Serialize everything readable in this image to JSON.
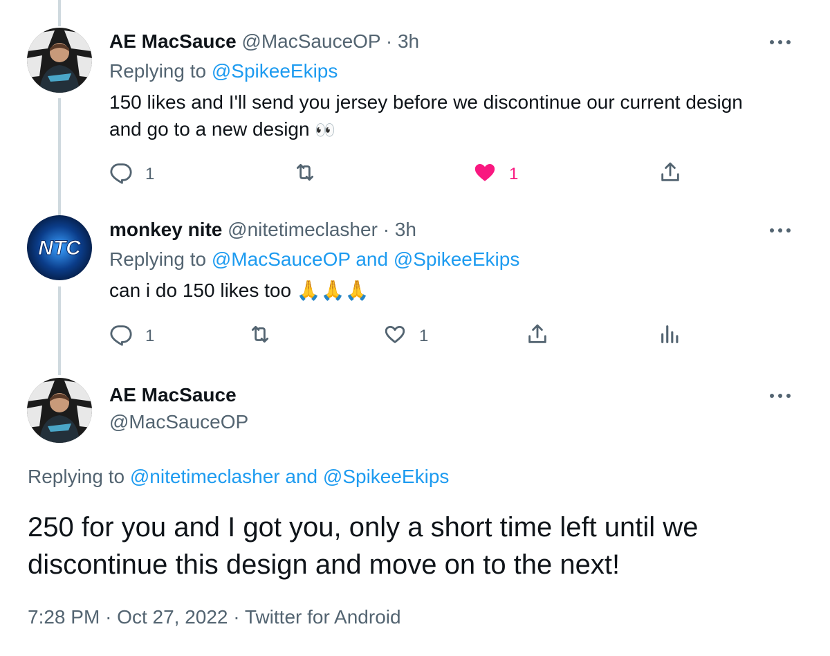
{
  "tweet1": {
    "name": "AE MacSauce",
    "handle": "@MacSauceOP",
    "time": "3h",
    "replying_prefix": "Replying to",
    "replying_to": "@SpikeeEkips",
    "text_line1": "150 likes and I'll send you jersey before we discontinue our current design",
    "text_line2": "and go to a new design",
    "emoji": "👀",
    "reply_count": "1",
    "like_count": "1",
    "liked": true
  },
  "tweet2": {
    "name": "monkey nite",
    "handle": "@nitetimeclasher",
    "time": "3h",
    "avatar_text": "NTC",
    "replying_prefix": "Replying to",
    "replying_to_1": "@MacSauceOP",
    "replying_and": "and",
    "replying_to_2": "@SpikeeEkips",
    "text": "can i do 150 likes too",
    "emoji": "🙏🙏🙏",
    "reply_count": "1",
    "like_count": "1",
    "liked": false
  },
  "tweet3": {
    "name": "AE MacSauce",
    "handle": "@MacSauceOP",
    "replying_prefix": "Replying to",
    "replying_to_1": "@nitetimeclasher",
    "replying_and": "and",
    "replying_to_2": "@SpikeeEkips",
    "text_line1": "250 for you and I got you, only a short time left until we",
    "text_line2": "discontinue this design and move on to the next!",
    "time": "7:28 PM",
    "date": "Oct 27, 2022",
    "source": "Twitter for Android"
  },
  "separator": "·",
  "colors": {
    "accent": "#1d9bf0",
    "like": "#f91880",
    "muted": "#536471",
    "thread_line": "#cfd9de",
    "text": "#0f1419"
  },
  "icons": [
    "reply-icon",
    "retweet-icon",
    "like-icon",
    "share-icon",
    "analytics-icon",
    "more-icon"
  ]
}
